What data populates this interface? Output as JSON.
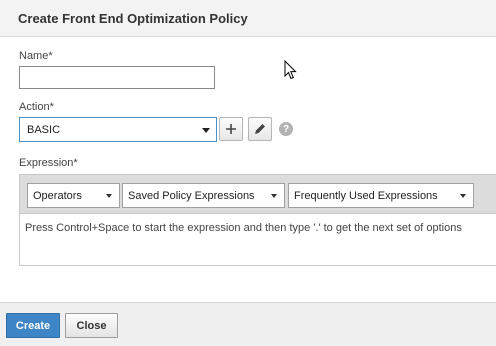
{
  "dialog": {
    "title": "Create Front End Optimization Policy"
  },
  "form": {
    "name_label": "Name*",
    "name_value": "",
    "action_label": "Action*",
    "action_value": "BASIC",
    "add_action_icon": "plus-icon",
    "edit_action_icon": "pencil-icon",
    "help_icon": "help-icon",
    "help_glyph": "?",
    "expression_label": "Expression*",
    "expression_toolbar": {
      "operators": "Operators",
      "saved_policy_expressions": "Saved Policy Expressions",
      "frequently_used_expressions": "Frequently Used Expressions"
    },
    "expression_hint": "Press Control+Space to start the expression and then type '.' to get the next set of options"
  },
  "footer": {
    "create_label": "Create",
    "close_label": "Close"
  },
  "colors": {
    "primary_button": "#3d85c6",
    "header_bg": "#f3f3f3",
    "toolbar_bg": "#dcdcdc"
  }
}
